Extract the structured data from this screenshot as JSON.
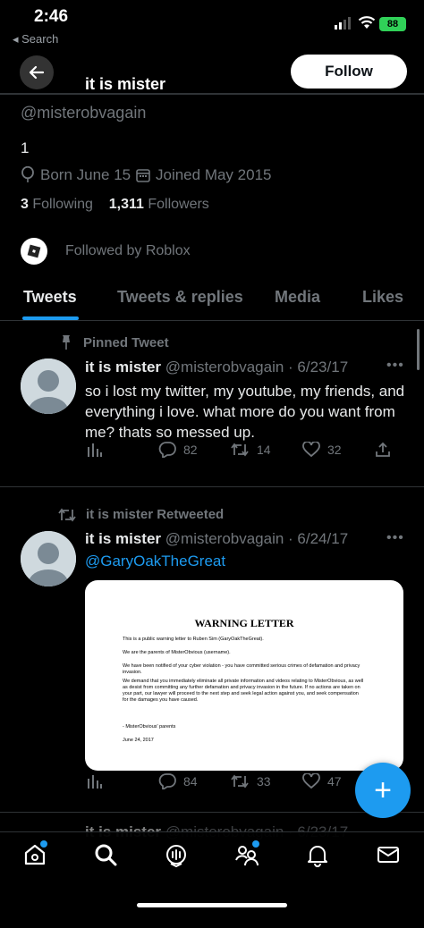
{
  "status_bar": {
    "time": "2:46",
    "back_label": "◂ Search",
    "battery": "88"
  },
  "header": {
    "title": "it is mister",
    "follow_label": "Follow"
  },
  "profile": {
    "handle": "@misterobvagain",
    "bio": "1",
    "born": "Born June 15",
    "joined": "Joined May 2015",
    "following_count": "3",
    "following_label": "Following",
    "followers_count": "1,311",
    "followers_label": "Followers",
    "followed_by": "Followed by Roblox"
  },
  "tabs": [
    {
      "label": "Tweets"
    },
    {
      "label": "Tweets & replies"
    },
    {
      "label": "Media"
    },
    {
      "label": "Likes"
    }
  ],
  "tweets": [
    {
      "context": "Pinned Tweet",
      "name": "it is mister",
      "handle_date": "@misterobvagain · 6/23/17",
      "text": "so i lost my twitter, my youtube, my friends, and everything i love. what more do you want from me? thats so messed up.",
      "replies": "82",
      "retweets": "14",
      "likes": "32"
    },
    {
      "context": "it is mister Retweeted",
      "name": "it is mister",
      "handle_date": "@misterobvagain · 6/24/17",
      "mention": "@GaryOakTheGreat",
      "replies": "84",
      "retweets": "33",
      "likes": "47",
      "letter": {
        "title": "WARNING LETTER",
        "p1": "This is a public warning letter to Ruben Sim (GaryOakTheGreat).",
        "p2": "We are the parents of MisterObvious (username).",
        "p3": "We have been notified of your cyber violation - you have committed serious crimes of defamation and privacy invasion.",
        "p4": "We demand that you immediately eliminate all private information and videos relating to MisterObvious, as well as desist from committing any further defamation and privacy invasion in the future. If no actions are taken on your part, our lawyer will proceed to the next step and seek legal action against you, and seek compensation for the damages you have caused.",
        "p5": "- MisterObvious' parents",
        "p6": "June 24, 2017"
      }
    },
    {
      "name": "it is mister",
      "handle_date": "@misterobvagain · 6/23/17"
    }
  ],
  "fab_label": "+",
  "colors": {
    "accent": "#1d9bf0",
    "background": "#000000",
    "muted": "#71767b"
  }
}
